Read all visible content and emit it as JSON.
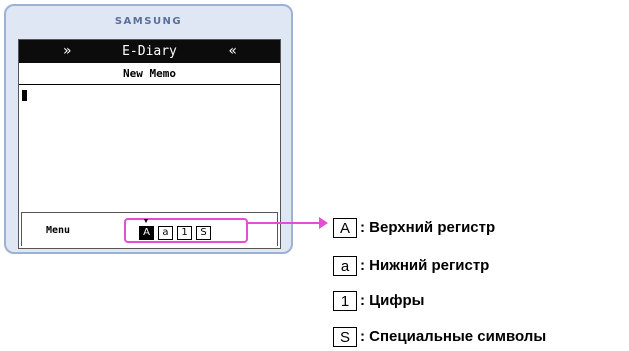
{
  "phone": {
    "brand": "SAMSUNG",
    "titlebar": {
      "title": "E-Diary",
      "left_arrow": "»",
      "right_arrow": "«"
    },
    "subtitle": "New Memo",
    "softkeys": {
      "menu_label": "Menu",
      "modes": [
        {
          "key": "A",
          "active": true
        },
        {
          "key": "a",
          "active": false
        },
        {
          "key": "1",
          "active": false
        },
        {
          "key": "S",
          "active": false
        }
      ],
      "active_marker": "▼"
    }
  },
  "legend": [
    {
      "key": "A",
      "description": ": Верхний регистр"
    },
    {
      "key": "a",
      "description": ": Нижний регистр"
    },
    {
      "key": "1",
      "description": ": Цифры"
    },
    {
      "key": "S",
      "description": ": Специальные символы"
    }
  ],
  "colors": {
    "accent": "#e54ed2",
    "frame": "#9fb1d3",
    "frame_fill": "#dfe7f5"
  }
}
